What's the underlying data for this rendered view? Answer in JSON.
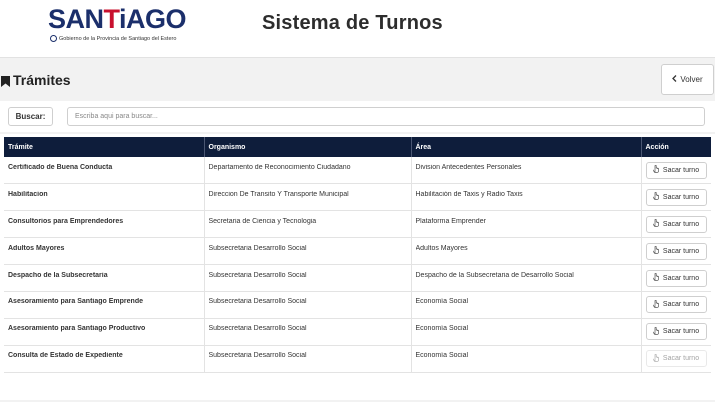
{
  "header": {
    "logo_text": "SANTIAGO",
    "logo_subtitle": "Gobierno de la Provincia de Santiago del Estero",
    "title": "Sistema de Turnos"
  },
  "section": {
    "title": "Trámites",
    "back_label": "Volver"
  },
  "search": {
    "label": "Buscar:",
    "placeholder": "Escriba aqui para buscar..."
  },
  "table": {
    "columns": [
      "Trámite",
      "Organismo",
      "Área",
      "Acción"
    ],
    "action_label": "Sacar turno",
    "rows": [
      {
        "tramite": "Certificado de Buena Conducta",
        "organismo": "Departamento de Reconocimiento Ciudadano",
        "area": "Division Antecedentes Personales"
      },
      {
        "tramite": "Habilitacion",
        "organismo": "Direccion De Transito Y Transporte Municipal",
        "area": "Habilitación de Taxis y Radio Taxis"
      },
      {
        "tramite": "Consultorios para Emprendedores",
        "organismo": "Secretaria de Ciencia y Tecnologia",
        "area": "Plataforma Emprender"
      },
      {
        "tramite": "Adultos Mayores",
        "organismo": "Subsecretaria Desarrollo Social",
        "area": "Adultos Mayores"
      },
      {
        "tramite": "Despacho de la Subsecretaria",
        "organismo": "Subsecretaria Desarrollo Social",
        "area": "Despacho de la Subsecretaria de Desarrollo Social"
      },
      {
        "tramite": "Asesoramiento para Santiago Emprende",
        "organismo": "Subsecretaria Desarrollo Social",
        "area": "Economía Social"
      },
      {
        "tramite": "Asesoramiento para Santiago Productivo",
        "organismo": "Subsecretaria Desarrollo Social",
        "area": "Economía Social"
      },
      {
        "tramite": "Consulta de Estado de Expediente",
        "organismo": "Subsecretaria Desarrollo Social",
        "area": "Economía Social"
      }
    ]
  },
  "icons": {
    "back": "chevron-left-icon",
    "section": "bookmark-icon",
    "action": "hand-pointer-icon"
  },
  "colors": {
    "table_header_bg": "#0e1d3b",
    "logo_blue": "#1b2f6b",
    "logo_red": "#c8102e"
  }
}
